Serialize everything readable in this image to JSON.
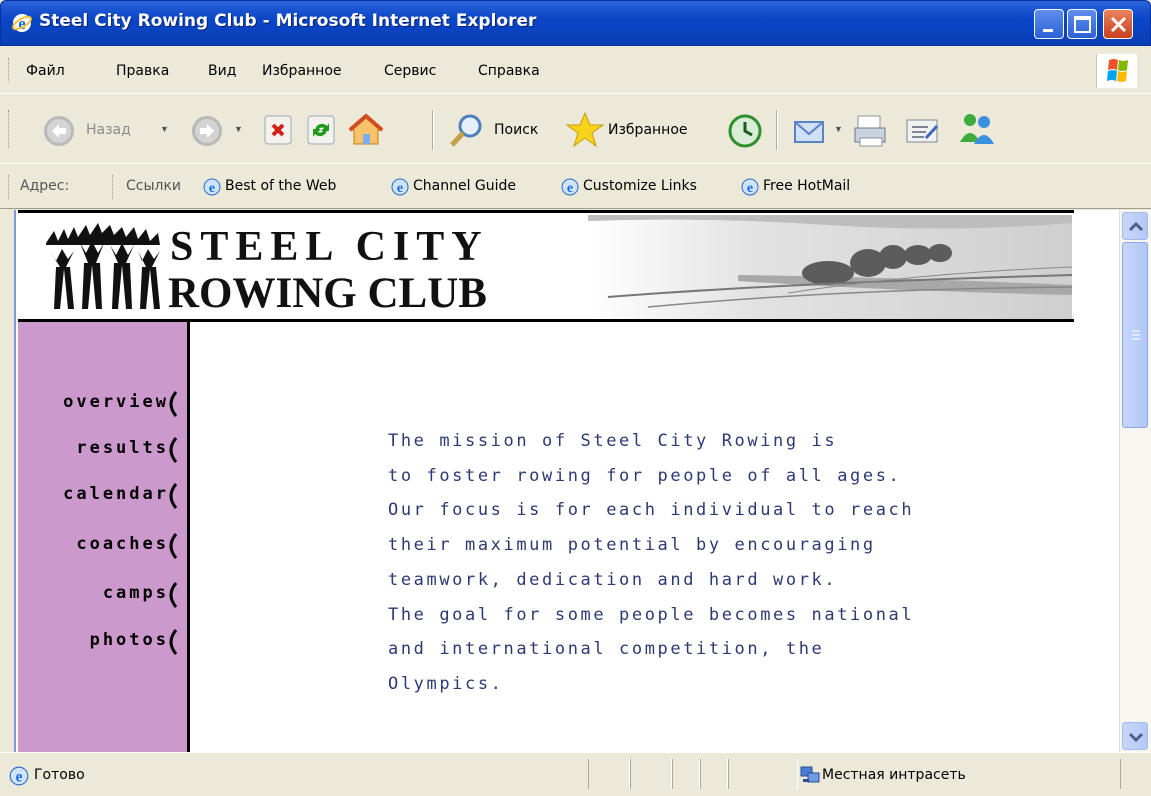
{
  "window": {
    "title": "Steel City Rowing Club - Microsoft Internet Explorer"
  },
  "menubar": {
    "items": [
      "Файл",
      "Правка",
      "Вид",
      "Избранное",
      "Сервис",
      "Справка"
    ]
  },
  "toolbar": {
    "back_label": "Назад",
    "search_label": "Поиск",
    "favorites_label": "Избранное"
  },
  "linksbar": {
    "address_label": "Адрес:",
    "links_label": "Ссылки",
    "links": [
      "Best of the Web",
      "Channel Guide",
      "Customize Links",
      "Free HotMail"
    ]
  },
  "page": {
    "logo_line1": "STEEL CITY",
    "logo_line2": "ROWING CLUB",
    "nav": [
      "overview",
      "results",
      "calendar",
      "coaches",
      "camps",
      "photos"
    ],
    "mission_lines": [
      "The mission of Steel City Rowing is",
      "to foster rowing for people of all ages.",
      "Our focus is for each individual to reach",
      "their maximum potential by encouraging",
      "teamwork, dedication and hard work.",
      "The goal for some people becomes national",
      "and international competition, the",
      "Olympics."
    ],
    "colors": {
      "sidebar": "#cc99cc",
      "mission_text": "#2c3a73"
    }
  },
  "statusbar": {
    "status": "Готово",
    "zone": "Местная интрасеть"
  }
}
